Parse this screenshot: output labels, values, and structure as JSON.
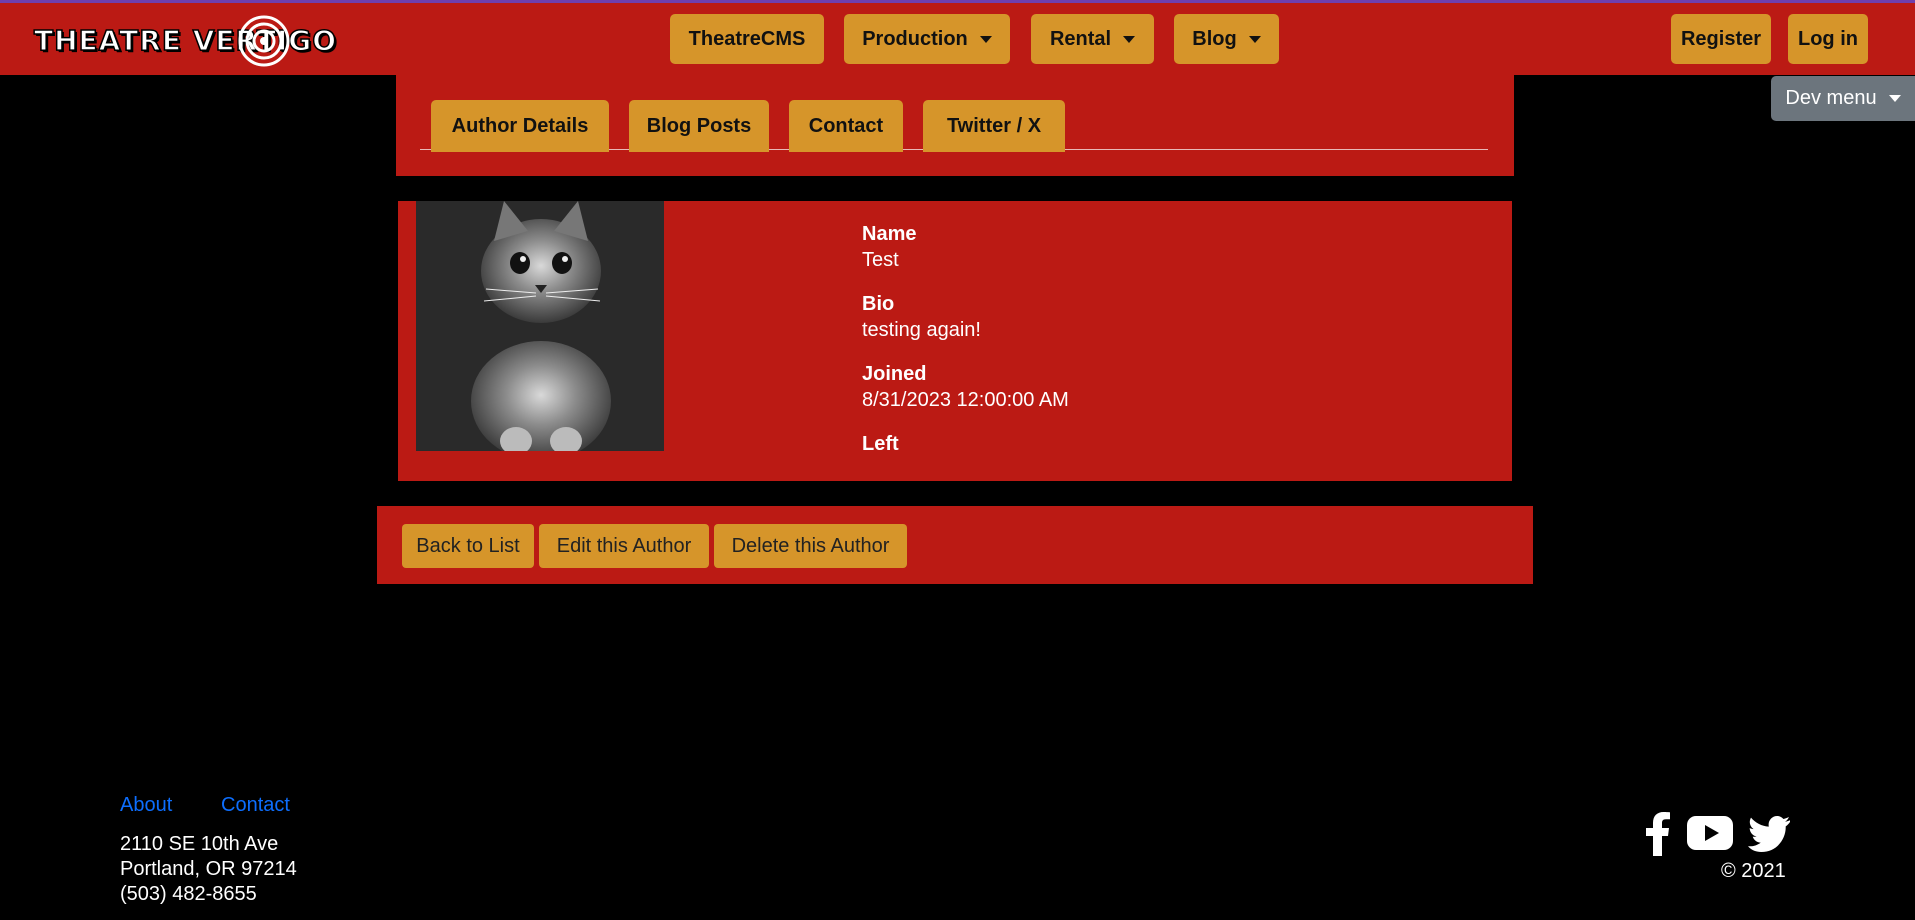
{
  "brand": {
    "logo_text": "THEATRE VERTIGO"
  },
  "nav": {
    "items": [
      {
        "label": "TheatreCMS"
      },
      {
        "label": "Production"
      },
      {
        "label": "Rental"
      },
      {
        "label": "Blog"
      }
    ],
    "register": "Register",
    "login": "Log in",
    "dev_menu": "Dev menu"
  },
  "tabs": [
    "Author Details",
    "Blog Posts",
    "Contact",
    "Twitter / X"
  ],
  "author": {
    "avatar_alt": "kitten photo",
    "fields": [
      {
        "label": "Name",
        "value": "Test"
      },
      {
        "label": "Bio",
        "value": "testing again!"
      },
      {
        "label": "Joined",
        "value": "8/31/2023 12:00:00 AM"
      },
      {
        "label": "Left",
        "value": ""
      }
    ]
  },
  "actions": {
    "back": "Back to List",
    "edit": "Edit this Author",
    "delete": "Delete this Author"
  },
  "footer": {
    "about": "About",
    "contact": "Contact",
    "address_line1": "2110 SE 10th Ave",
    "address_line2": "Portland, OR 97214",
    "phone": "(503) 482-8655",
    "copyright": "© 2021",
    "social_icons": [
      "facebook-icon",
      "youtube-icon",
      "twitter-icon"
    ]
  },
  "colors": {
    "brand_red": "#bb1a14",
    "button_gold": "#d6952a",
    "dev_menu_gray": "#6c757d",
    "link_blue": "#0d6efd"
  }
}
